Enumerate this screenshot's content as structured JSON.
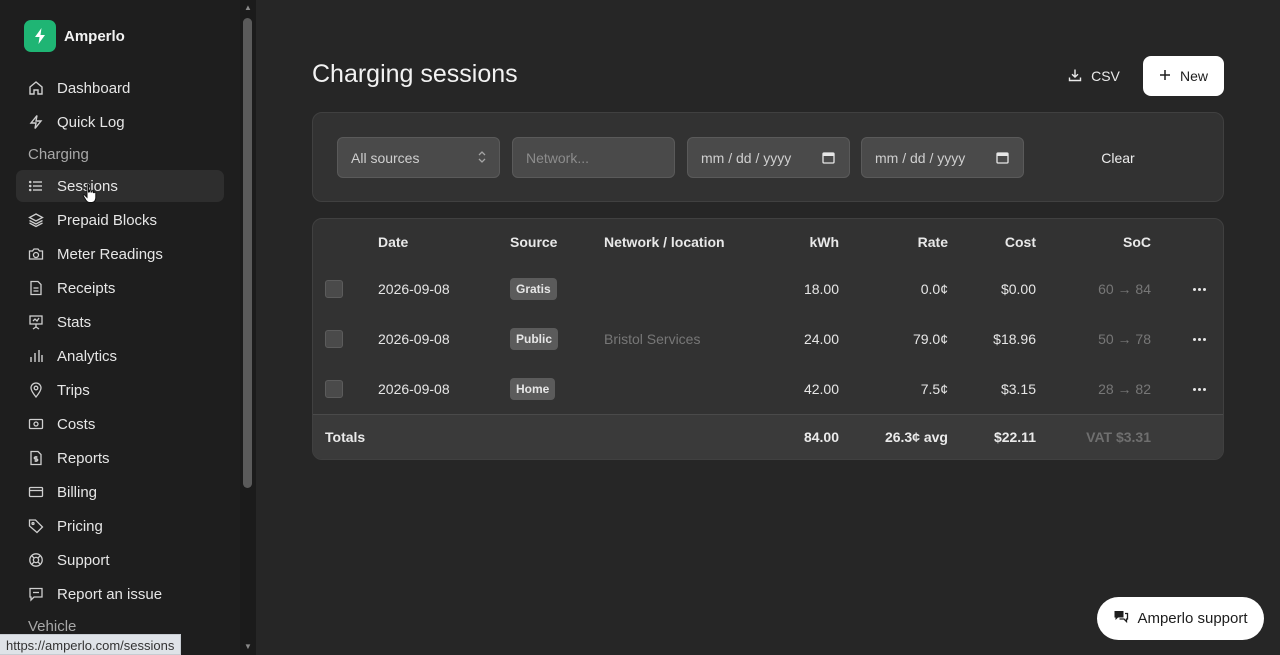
{
  "app": {
    "name": "Amperlo"
  },
  "sidebar": {
    "items": [
      {
        "label": "Dashboard",
        "icon": "home-icon"
      },
      {
        "label": "Quick Log",
        "icon": "zap-icon"
      }
    ],
    "section_charging": "Charging",
    "charging_items": [
      {
        "label": "Sessions",
        "icon": "list-icon",
        "active": true
      },
      {
        "label": "Prepaid Blocks",
        "icon": "layers-icon"
      },
      {
        "label": "Meter Readings",
        "icon": "camera-icon"
      },
      {
        "label": "Receipts",
        "icon": "file-icon"
      },
      {
        "label": "Stats",
        "icon": "presentation-icon"
      },
      {
        "label": "Analytics",
        "icon": "bar-chart-icon"
      },
      {
        "label": "Trips",
        "icon": "map-pin-icon"
      },
      {
        "label": "Costs",
        "icon": "banknote-icon"
      },
      {
        "label": "Reports",
        "icon": "file-dollar-icon"
      },
      {
        "label": "Billing",
        "icon": "credit-card-icon"
      },
      {
        "label": "Pricing",
        "icon": "tag-icon"
      },
      {
        "label": "Support",
        "icon": "lifebuoy-icon"
      },
      {
        "label": "Report an issue",
        "icon": "message-icon"
      }
    ],
    "section_vehicle": "Vehicle"
  },
  "status_url": "https://amperlo.com/sessions",
  "page": {
    "title": "Charging sessions",
    "csv_label": "CSV",
    "new_label": "New"
  },
  "filters": {
    "source_selected": "All sources",
    "network_placeholder": "Network...",
    "date_from_placeholder": "mm / dd / yyyy",
    "date_to_placeholder": "mm / dd / yyyy",
    "clear_label": "Clear"
  },
  "table": {
    "headers": {
      "date": "Date",
      "source": "Source",
      "network": "Network / location",
      "kwh": "kWh",
      "rate": "Rate",
      "cost": "Cost",
      "soc": "SoC"
    },
    "rows": [
      {
        "date": "2026-09-08",
        "source": "Gratis",
        "network": "",
        "kwh": "18.00",
        "rate": "0.0¢",
        "cost": "$0.00",
        "soc": "60 → 84"
      },
      {
        "date": "2026-09-08",
        "source": "Public",
        "network": "Bristol Services",
        "kwh": "24.00",
        "rate": "79.0¢",
        "cost": "$18.96",
        "soc": "50 → 78"
      },
      {
        "date": "2026-09-08",
        "source": "Home",
        "network": "",
        "kwh": "42.00",
        "rate": "7.5¢",
        "cost": "$3.15",
        "soc": "28 → 82"
      }
    ],
    "totals": {
      "label": "Totals",
      "kwh": "84.00",
      "rate": "26.3¢ avg",
      "cost": "$22.11",
      "vat": "VAT $3.31"
    }
  },
  "support": {
    "label": "Amperlo support"
  },
  "colors": {
    "brand": "#1fb574",
    "background": "#262626",
    "sidebar": "#1e1e1e"
  }
}
